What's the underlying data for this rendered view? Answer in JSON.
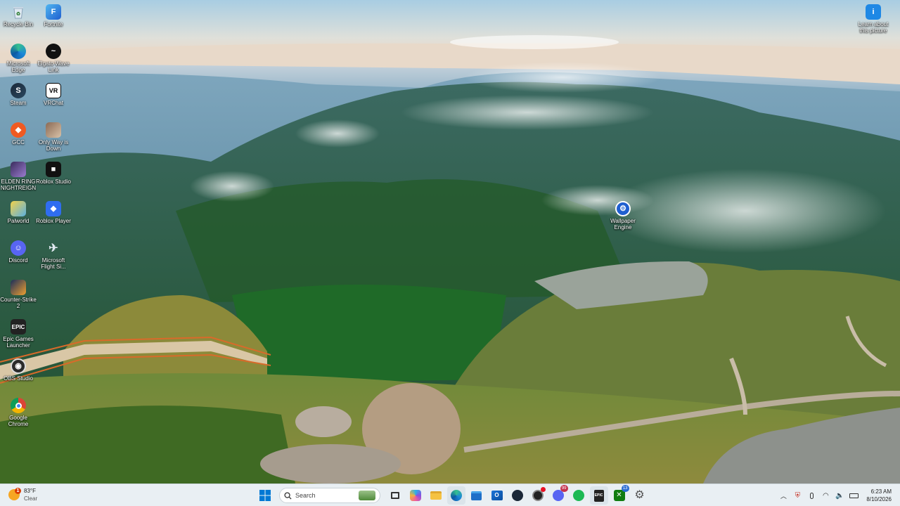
{
  "desktop": {
    "icons": [
      {
        "label": "Recycle Bin",
        "icon": "recycle-bin-icon"
      },
      {
        "label": "Fortnite",
        "icon": "fortnite-icon"
      },
      {
        "label": "Microsoft Edge",
        "icon": "edge-icon"
      },
      {
        "label": "Elgato Wave Link",
        "icon": "elgato-wave-link-icon"
      },
      {
        "label": "Steam",
        "icon": "steam-icon"
      },
      {
        "label": "VRChat",
        "icon": "vrchat-icon"
      },
      {
        "label": "GCC",
        "icon": "gcc-icon"
      },
      {
        "label": "Only Way is Down",
        "icon": "only-way-is-down-icon"
      },
      {
        "label": "ELDEN RING NIGHTREIGN",
        "icon": "elden-ring-icon"
      },
      {
        "label": "Roblox Studio",
        "icon": "roblox-studio-icon"
      },
      {
        "label": "Palworld",
        "icon": "palworld-icon"
      },
      {
        "label": "Roblox Player",
        "icon": "roblox-player-icon"
      },
      {
        "label": "Discord",
        "icon": "discord-icon"
      },
      {
        "label": "Microsoft Flight Si...",
        "icon": "flight-simulator-icon"
      },
      {
        "label": "Counter-Strike 2",
        "icon": "counter-strike-icon"
      },
      {
        "label": "Epic Games Launcher",
        "icon": "epic-games-icon"
      },
      {
        "label": "OBS Studio",
        "icon": "obs-icon"
      },
      {
        "label": "Google Chrome",
        "icon": "chrome-icon"
      },
      {
        "label": "Wallpaper Engine",
        "icon": "wallpaper-engine-icon"
      },
      {
        "label": "Learn about this picture",
        "icon": "learn-picture-icon"
      }
    ]
  },
  "taskbar": {
    "weather": {
      "temp": "83°F",
      "condition": "Clear",
      "alert": "1"
    },
    "search_label": "Search",
    "apps": [
      {
        "name": "start-button",
        "icon": "windows-icon"
      },
      {
        "name": "task-view",
        "icon": "task-view-icon"
      },
      {
        "name": "copilot",
        "icon": "copilot-icon"
      },
      {
        "name": "file-explorer",
        "icon": "folder-icon"
      },
      {
        "name": "edge",
        "icon": "edge-icon"
      },
      {
        "name": "microsoft-store",
        "icon": "store-icon"
      },
      {
        "name": "outlook",
        "icon": "outlook-icon"
      },
      {
        "name": "steam",
        "icon": "steam-icon"
      },
      {
        "name": "obs",
        "icon": "obs-icon"
      },
      {
        "name": "discord",
        "icon": "discord-icon",
        "badge": "99"
      },
      {
        "name": "spotify",
        "icon": "spotify-icon"
      },
      {
        "name": "epic-games",
        "icon": "epic-games-icon"
      },
      {
        "name": "xbox",
        "icon": "xbox-icon",
        "badge": "13"
      },
      {
        "name": "settings",
        "icon": "gear-icon"
      }
    ],
    "time": "6:23 AM",
    "date": "8/10/2026"
  },
  "colors": {
    "taskbar_bg": "#e9eff3",
    "accent": "#0078d4"
  }
}
